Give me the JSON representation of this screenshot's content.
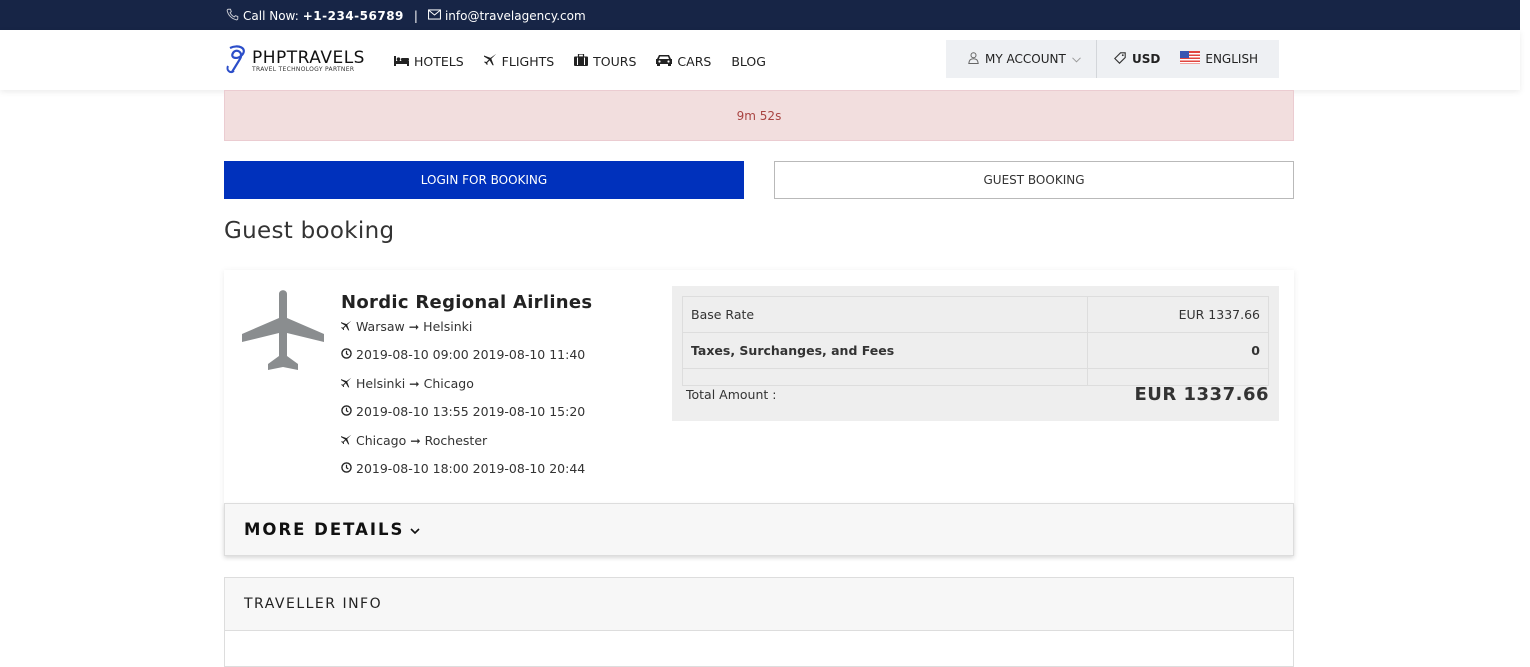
{
  "topbar": {
    "call_label": "Call Now:",
    "phone": "+1-234-56789",
    "separator": "|",
    "email": "info@travelagency.com"
  },
  "logo": {
    "brand": "PHPTRAVELS",
    "tagline": "TRAVEL TECHNOLOGY PARTNER"
  },
  "menu": [
    {
      "label": "HOTELS",
      "icon": "bed-icon"
    },
    {
      "label": "FLIGHTS",
      "icon": "plane-icon"
    },
    {
      "label": "TOURS",
      "icon": "suitcase-icon"
    },
    {
      "label": "CARS",
      "icon": "car-icon"
    },
    {
      "label": "BLOG",
      "icon": ""
    }
  ],
  "account": {
    "label": "MY ACCOUNT",
    "currency": "USD",
    "language": "ENGLISH"
  },
  "timer": {
    "text": "9m 52s"
  },
  "buttons": {
    "login": "LOGIN FOR BOOKING",
    "guest": "GUEST BOOKING"
  },
  "page": {
    "title": "Guest booking"
  },
  "booking": {
    "airline": "Nordic Regional Airlines",
    "legs": [
      {
        "route": "Warsaw ➞ Helsinki",
        "times": "2019-08-10 09:00 2019-08-10 11:40"
      },
      {
        "route": "Helsinki ➞ Chicago",
        "times": "2019-08-10 13:55 2019-08-10 15:20"
      },
      {
        "route": "Chicago ➞ Rochester",
        "times": "2019-08-10 18:00 2019-08-10 20:44"
      }
    ],
    "price": {
      "base_label": "Base Rate",
      "base_value": "EUR 1337.66",
      "taxes_label": "Taxes, Surchanges, and Fees",
      "taxes_value": "0",
      "total_label": "Total Amount :",
      "total_value": "EUR 1337.66"
    },
    "more_details": "MORE DETAILS"
  },
  "traveller": {
    "title": "TRAVELLER INFO"
  },
  "colors": {
    "topbar": "#172546",
    "primary": "#0031bc",
    "alert_bg": "#f2dede",
    "alert_text": "#a94442"
  }
}
